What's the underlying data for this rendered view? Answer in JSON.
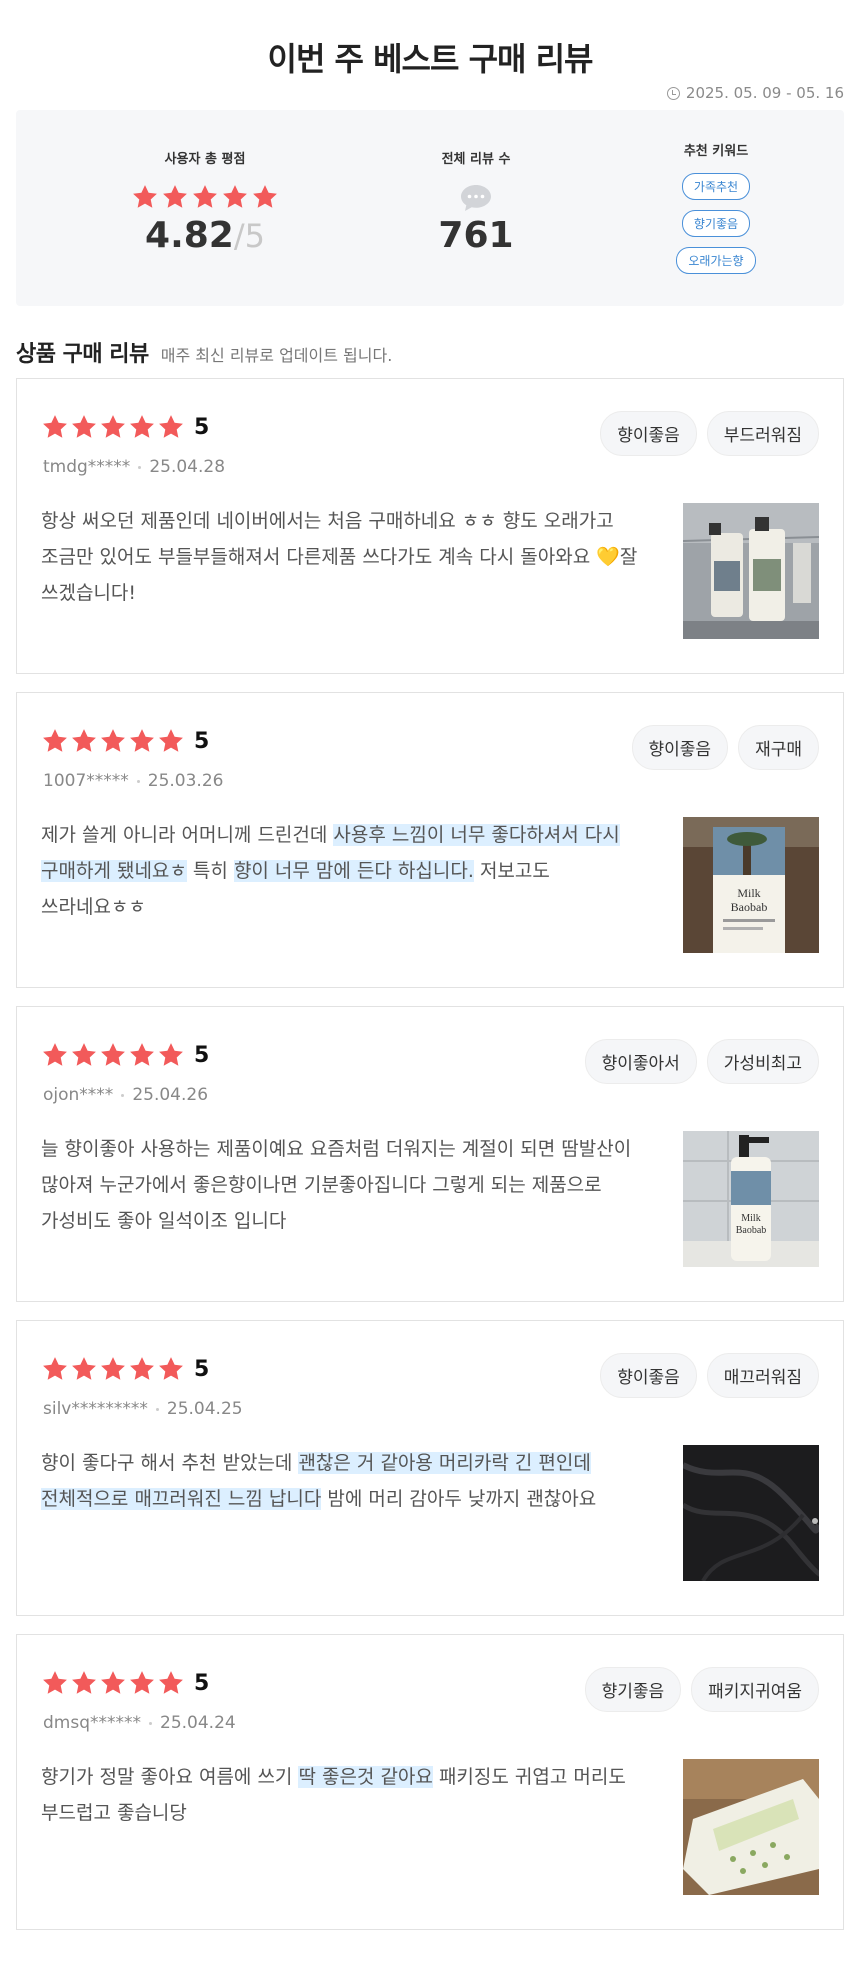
{
  "page": {
    "title": "이번 주 베스트 구매 리뷰",
    "date_range": "2025. 05. 09 - 05. 16"
  },
  "summary": {
    "rating_label": "사용자 총 평점",
    "rating_value": "4.82",
    "rating_slash": "/",
    "rating_max": "5",
    "count_label": "전체 리뷰 수",
    "count_value": "761",
    "keywords_label": "추천 키워드",
    "keywords": [
      "가족추천",
      "향기좋음",
      "오래가는향"
    ]
  },
  "section": {
    "title": "상품 구매 리뷰",
    "subtitle": "매주 최신 리뷰로 업데이트 됩니다."
  },
  "reviews": [
    {
      "score": "5",
      "user": "tmdg*****",
      "date": "25.04.28",
      "tags": [
        "향이좋음",
        "부드러워짐"
      ],
      "text_parts": [
        "항상 써오던 제품인데 네이버에서는 처음 구매하네요 ㅎㅎ 향도 오래가고 조금만 있어도 부들부들해져서 다른제품 쓰다가도 계속 다시 돌아와요 💛잘 쓰겠습니다!"
      ]
    },
    {
      "score": "5",
      "user": "1007*****",
      "date": "25.03.26",
      "tags": [
        "향이좋음",
        "재구매"
      ],
      "text_parts": [
        "제가 쓸게 아니라 어머니께 드린건데 ",
        "사용후 느낌이 너무 좋다하셔서 다시 구매하게 됐네요ㅎ",
        " 특히 ",
        "향이 너무 맘에 든다 하십니다.",
        " 저보고도 쓰라네요ㅎㅎ"
      ]
    },
    {
      "score": "5",
      "user": "ojon****",
      "date": "25.04.26",
      "tags": [
        "향이좋아서",
        "가성비최고"
      ],
      "text_parts": [
        "늘 향이좋아 사용하는 제품이예요 요즘처럼 더워지는 계절이 되면 땀발산이 많아져 누군가에서 좋은향이나면 기분좋아집니다 그렇게 되는 제품으로 가성비도 좋아 일석이조 입니다"
      ]
    },
    {
      "score": "5",
      "user": "silv*********",
      "date": "25.04.25",
      "tags": [
        "향이좋음",
        "매끄러워짐"
      ],
      "text_parts": [
        "향이 좋다구 해서 추천 받았는데 ",
        "괜찮은 거 같아용 머리카락 긴 편인데 전체적으로 매끄러워진 느낌 납니다",
        " 밤에 머리 감아두 낮까지 괜찮아요"
      ]
    },
    {
      "score": "5",
      "user": "dmsq******",
      "date": "25.04.24",
      "tags": [
        "향기좋음",
        "패키지귀여움"
      ],
      "text_parts": [
        "향기가 정말 좋아요 여름에 쓰기 ",
        "딱 좋은것 같아요",
        " 패키징도 귀엽고 머리도 부드럽고 좋습니당"
      ]
    }
  ],
  "photos": [
    {
      "label": "bottles on shelf photo"
    },
    {
      "label": "Milk Baobab bottle photo",
      "brand_text": [
        "Milk",
        "Baobab"
      ]
    },
    {
      "label": "pump bottle photo",
      "brand_text": [
        "Milk",
        "Baobab"
      ]
    },
    {
      "label": "dark hair photo"
    },
    {
      "label": "product box photo"
    }
  ],
  "colors": {
    "star": "#f25a5a",
    "highlight": "#dcefff",
    "keyword": "#3a86d1"
  }
}
